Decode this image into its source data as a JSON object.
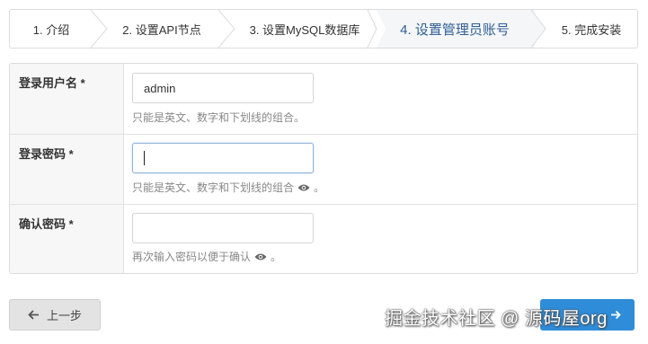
{
  "steps": [
    {
      "label": "1. 介绍"
    },
    {
      "label": "2. 设置API节点"
    },
    {
      "label": "3. 设置MySQL数据库"
    },
    {
      "label": "4. 设置管理员账号"
    },
    {
      "label": "5. 完成安装"
    }
  ],
  "active_step": 4,
  "form": {
    "username": {
      "label": "登录用户名 *",
      "value": "admin",
      "hint": "只能是英文、数字和下划线的组合。"
    },
    "password": {
      "label": "登录密码 *",
      "value": "",
      "hint_prefix": "只能是英文、数字和下划线的组合",
      "hint_suffix": "。",
      "icon": "eye-icon"
    },
    "confirm": {
      "label": "确认密码 *",
      "value": "",
      "hint_prefix": "再次输入密码以便于确认",
      "hint_suffix": "。",
      "icon": "eye-icon"
    }
  },
  "buttons": {
    "prev_label": "上一步",
    "prev_icon": "arrow-left-icon",
    "next_icon": "arrow-right-icon"
  },
  "watermark": "掘金技术社区 @ 源码屋org",
  "colors": {
    "active_step_text": "#2f5f93",
    "next_button": "#2f8cd8"
  }
}
